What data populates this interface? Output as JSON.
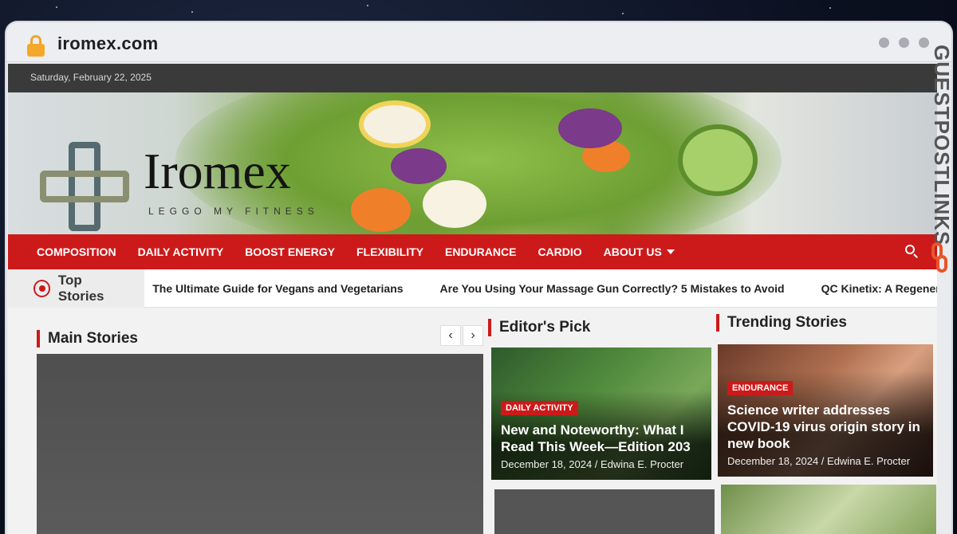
{
  "browser": {
    "url": "iromex.com"
  },
  "topbar": {
    "date": "Saturday, February 22, 2025"
  },
  "header": {
    "brand": "Iromex",
    "tagline": "LEGGO MY FITNESS"
  },
  "nav": {
    "items": [
      "COMPOSITION",
      "DAILY ACTIVITY",
      "BOOST ENERGY",
      "FLEXIBILITY",
      "ENDURANCE",
      "CARDIO",
      "ABOUT US"
    ]
  },
  "ticker": {
    "label": "Top Stories",
    "items": [
      "The Ultimate Guide for Vegans and Vegetarians",
      "Are You Using Your Massage Gun Correctly? 5 Mistakes to Avoid",
      "QC Kinetix: A Regenerative Me"
    ]
  },
  "sections": {
    "main": "Main Stories",
    "editors": "Editor's Pick",
    "trending": "Trending Stories"
  },
  "editors_card": {
    "badge": "DAILY ACTIVITY",
    "title": "New and Noteworthy: What I Read This Week—Edition 203",
    "meta": "December 18, 2024 / Edwina E. Procter"
  },
  "trending_card": {
    "badge": "ENDURANCE",
    "title": "Science writer addresses COVID-19 virus origin story in new book",
    "meta": "December 18, 2024 / Edwina E. Procter"
  },
  "watermark": {
    "text": "GUESTPOSTLINKS"
  },
  "colors": {
    "accent": "#cc1a1a",
    "topbar": "#3a3a3a",
    "watermark": "#e8552a"
  }
}
